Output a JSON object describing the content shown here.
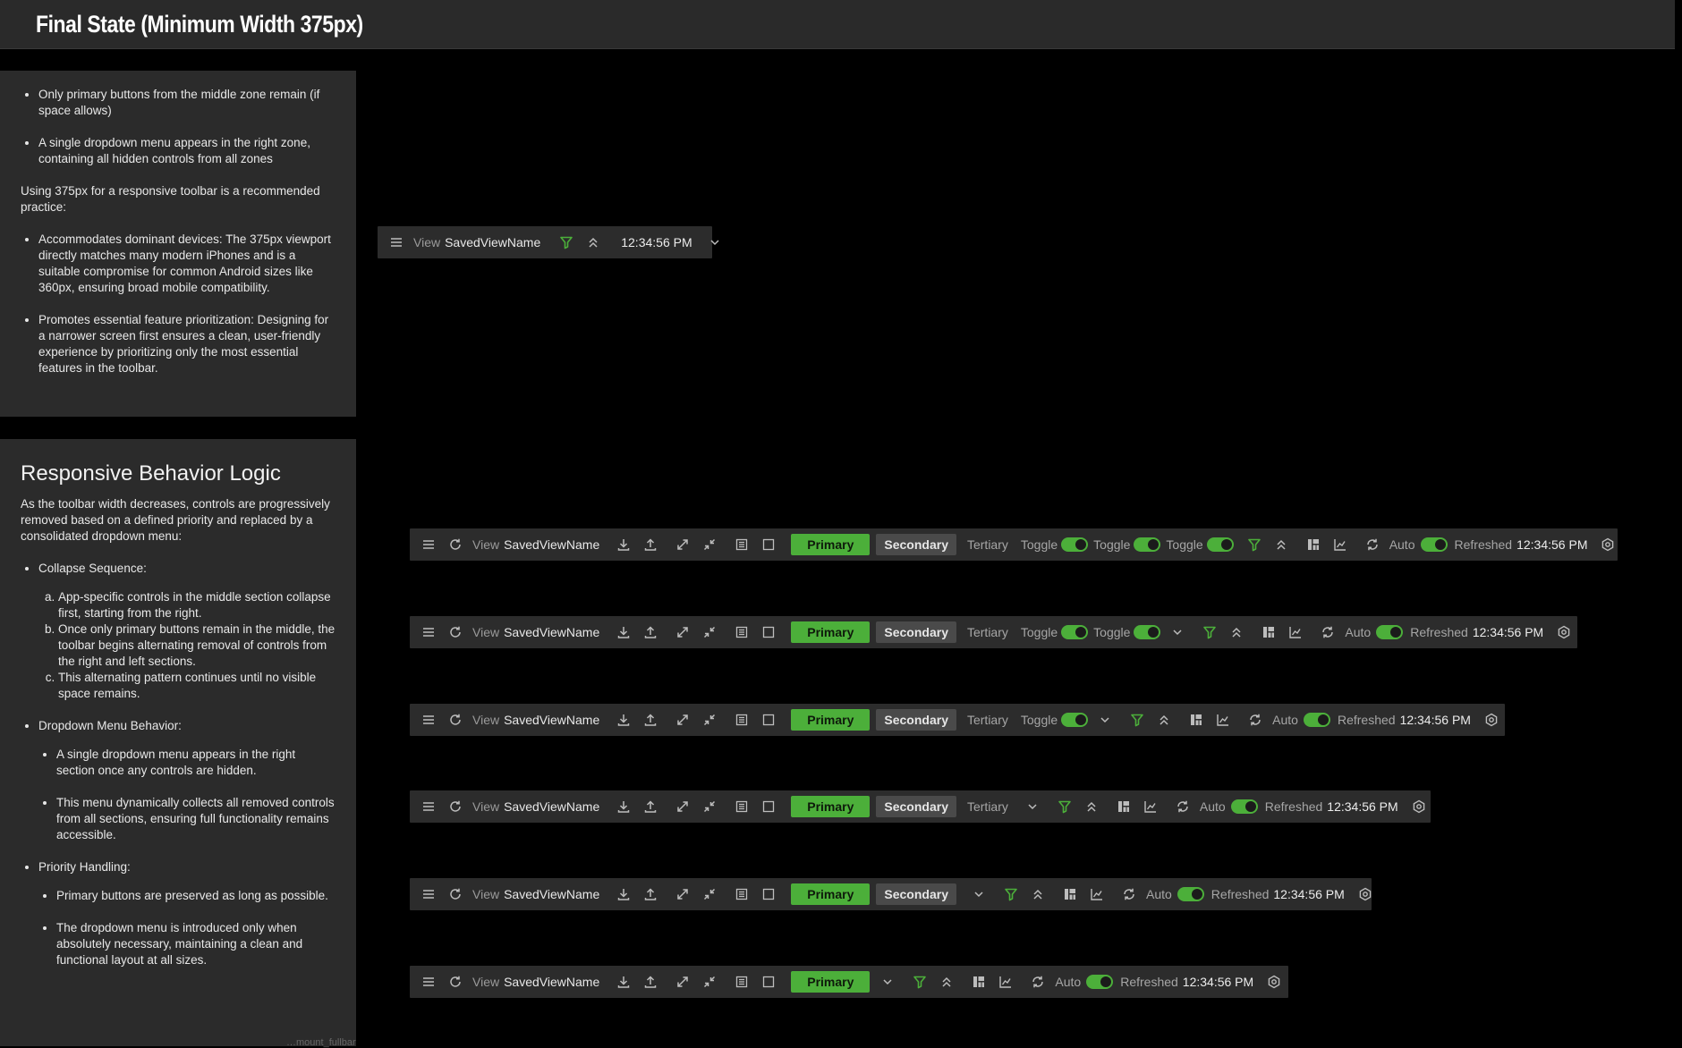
{
  "page": {
    "title": "Final State (Minimum Width 375px)",
    "footer_fragment": "…mount_fullbar"
  },
  "panel1": {
    "bullets_a": [
      "Only primary buttons from the middle zone remain (if space allows)",
      "A single dropdown menu appears in the right zone, containing all hidden controls from all zones"
    ],
    "paragraph": "Using 375px for a responsive toolbar is a recommended practice:",
    "bullets_b": [
      "Accommodates dominant devices: The 375px viewport directly matches many modern iPhones and is a suitable compromise for common Android sizes like 360px, ensuring broad mobile compatibility.",
      "Promotes essential feature prioritization: Designing for a narrower screen first ensures a clean, user-friendly experience by prioritizing only the most essential features in the toolbar."
    ]
  },
  "panel2": {
    "heading": "Responsive Behavior Logic",
    "intro": "As the toolbar width decreases, controls are progressively removed based on a defined priority and replaced by a consolidated dropdown menu:",
    "collapse_title": "Collapse Sequence:",
    "collapse_items": [
      "App-specific controls in the middle section collapse first, starting from the right.",
      "Once only primary buttons remain in the middle, the toolbar begins alternating removal of controls from the right and left sections.",
      "This alternating pattern continues until no visible space remains."
    ],
    "dropdown_title": "Dropdown Menu Behavior:",
    "dropdown_items": [
      "A single dropdown menu appears in the right section once any controls are hidden.",
      "This menu dynamically collects all removed controls from all sections, ensuring full functionality remains accessible."
    ],
    "priority_title": "Priority Handling:",
    "priority_items": [
      "Primary buttons are preserved as long as possible.",
      "The dropdown menu is introduced only when absolutely necessary, maintaining a clean and functional layout at all sizes."
    ]
  },
  "toolbar": {
    "view_label": "View",
    "view_name": "SavedViewName",
    "primary": "Primary",
    "secondary": "Secondary",
    "tertiary": "Tertiary",
    "toggle": "Toggle",
    "auto": "Auto",
    "refreshed": "Refreshed",
    "time": "12:34:56 PM"
  },
  "colors": {
    "accent_green": "#4caf3a",
    "bg": "#000000",
    "panel": "#2b2b2b",
    "toolbar": "#2c2c2c"
  },
  "icons": [
    "menu-icon",
    "refresh-icon",
    "download-icon",
    "upload-icon",
    "expand-icon",
    "collapse-icon",
    "list-icon",
    "select-icon",
    "filter-icon",
    "double-chevron-up-icon",
    "layout-icon",
    "chart-icon",
    "auto-refresh-icon",
    "settings-icon",
    "chevron-down-icon"
  ]
}
